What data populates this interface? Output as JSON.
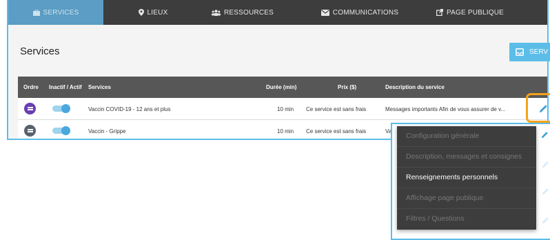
{
  "nav": {
    "items": [
      {
        "label": "SERVICES",
        "icon": "briefcase-icon",
        "active": true
      },
      {
        "label": "LIEUX",
        "icon": "map-pin-icon"
      },
      {
        "label": "RESSOURCES",
        "icon": "users-icon"
      },
      {
        "label": "COMMUNICATIONS",
        "icon": "envelope-icon"
      },
      {
        "label": "PAGE PUBLIQUE",
        "icon": "external-link-icon"
      }
    ]
  },
  "page": {
    "title": "Services",
    "add_button_label": "SERV"
  },
  "table": {
    "headers": [
      "Ordre",
      "Inactif / Actif",
      "Services",
      "Durée (min)",
      "Prix ($)",
      "Description du service"
    ],
    "rows": [
      {
        "order_color": "#6a3fb0",
        "active": true,
        "service": "Vaccin COVID-19 - 12 ans et plus",
        "duration": "10 min",
        "price": "Ce service est sans frais",
        "description": "Messages importants Afin de vous assurer de v..."
      },
      {
        "order_color": "#57626e",
        "active": true,
        "service": "Vaccin - Grippe",
        "duration": "10 min",
        "price": "Ce service est sans frais",
        "description": "Vacc"
      }
    ]
  },
  "edit_menu": {
    "items": [
      {
        "label": "Configuration générale",
        "enabled": false
      },
      {
        "label": "Description, messages et consignes",
        "enabled": false
      },
      {
        "label": "Renseignements personnels",
        "enabled": true
      },
      {
        "label": "Affichage page publique",
        "enabled": false
      },
      {
        "label": "Filtres / Questions",
        "enabled": false
      }
    ]
  },
  "colors": {
    "accent": "#5bbde8",
    "highlight": "#f5a21a",
    "navbar": "#3d3d3d",
    "table_header": "#575757"
  }
}
